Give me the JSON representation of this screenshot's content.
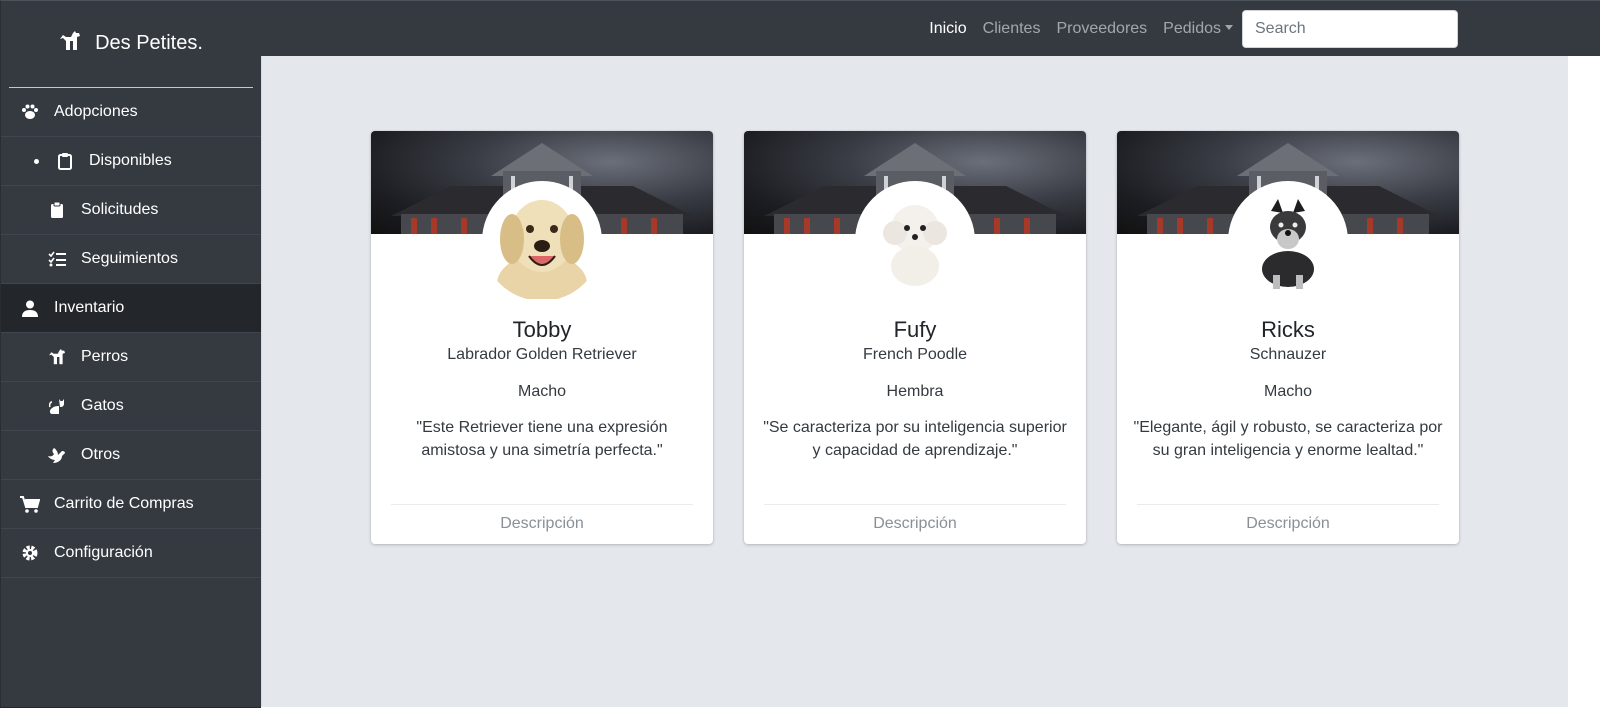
{
  "brand": {
    "name": "Des Petites.",
    "icon": "dog-icon"
  },
  "sidebar": {
    "items": [
      {
        "label": "Adopciones",
        "icon": "paw-icon",
        "level": "top"
      },
      {
        "label": "Disponibles",
        "icon": "clipboard-icon",
        "level": "sub"
      },
      {
        "label": "Solicitudes",
        "icon": "clipboard-icon",
        "level": "sub"
      },
      {
        "label": "Seguimientos",
        "icon": "tasks-icon",
        "level": "sub"
      },
      {
        "label": "Inventario",
        "icon": "user-icon",
        "level": "top"
      },
      {
        "label": "Perros",
        "icon": "dog-icon",
        "level": "sub"
      },
      {
        "label": "Gatos",
        "icon": "cat-icon",
        "level": "sub"
      },
      {
        "label": "Otros",
        "icon": "dove-icon",
        "level": "sub"
      },
      {
        "label": "Carrito de Compras",
        "icon": "cart-icon",
        "level": "top"
      },
      {
        "label": "Configuración",
        "icon": "gear-icon",
        "level": "top"
      }
    ]
  },
  "nav": {
    "links": [
      "Inicio",
      "Clientes",
      "Proveedores",
      "Pedidos"
    ],
    "search_placeholder": "Search"
  },
  "cards": [
    {
      "name": "Tobby",
      "breed": "Labrador Golden Retriever",
      "sex": "Macho",
      "description": "\"Este Retriever tiene una expresión amistosa y una simetría perfecta.\"",
      "footer": "Descripción"
    },
    {
      "name": "Fufy",
      "breed": "French Poodle",
      "sex": "Hembra",
      "description": "\"Se caracteriza por su inteligencia superior y capacidad de aprendizaje.\"",
      "footer": "Descripción"
    },
    {
      "name": "Ricks",
      "breed": "Schnauzer",
      "sex": "Macho",
      "description": "\"Elegante, ágil y robusto, se caracteriza por su gran inteligencia y enorme lealtad.\"",
      "footer": "Descripción"
    }
  ],
  "colors": {
    "sidebar": "#343a40",
    "content_bg": "#e4e7ec",
    "active_item": "#23272b"
  }
}
